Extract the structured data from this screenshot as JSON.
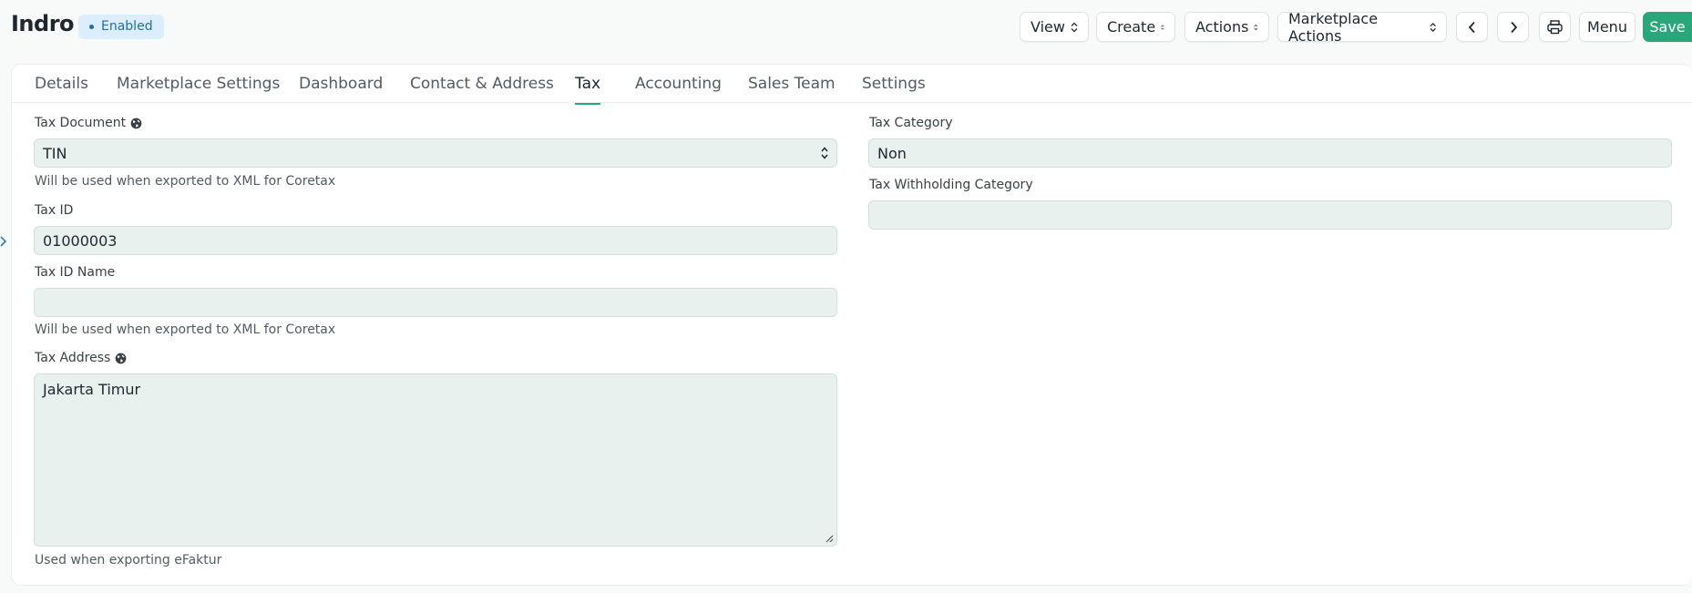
{
  "header": {
    "title": "Indro",
    "status_badge": "Enabled",
    "buttons": {
      "view": "View",
      "create": "Create",
      "actions": "Actions",
      "marketplace_actions": "Marketplace Actions",
      "menu": "Menu",
      "save": "Save"
    },
    "icons": [
      "chevron-left-icon",
      "chevron-right-icon",
      "printer-icon"
    ]
  },
  "tabs": [
    {
      "label": "Details"
    },
    {
      "label": "Marketplace Settings"
    },
    {
      "label": "Dashboard"
    },
    {
      "label": "Contact & Address"
    },
    {
      "label": "Tax",
      "active": true
    },
    {
      "label": "Accounting"
    },
    {
      "label": "Sales Team"
    },
    {
      "label": "Settings"
    }
  ],
  "form": {
    "tax_document": {
      "label": "Tax Document",
      "value": "TIN",
      "help": "Will be used when exported to XML for Coretax"
    },
    "tax_id": {
      "label": "Tax ID",
      "value": "01000003"
    },
    "tax_id_name": {
      "label": "Tax ID Name",
      "value": "",
      "help": "Will be used when exported to XML for Coretax"
    },
    "tax_address": {
      "label": "Tax Address",
      "value": "Jakarta Timur",
      "help": "Used when exporting eFaktur"
    },
    "tax_category": {
      "label": "Tax Category",
      "value": "Non"
    },
    "tax_withholding_category": {
      "label": "Tax Withholding Category",
      "value": ""
    }
  },
  "colors": {
    "primary": "#28a77b",
    "badge_bg": "#dceefb",
    "badge_text": "#1f6fa8",
    "field_bg": "#e9f1ef"
  }
}
